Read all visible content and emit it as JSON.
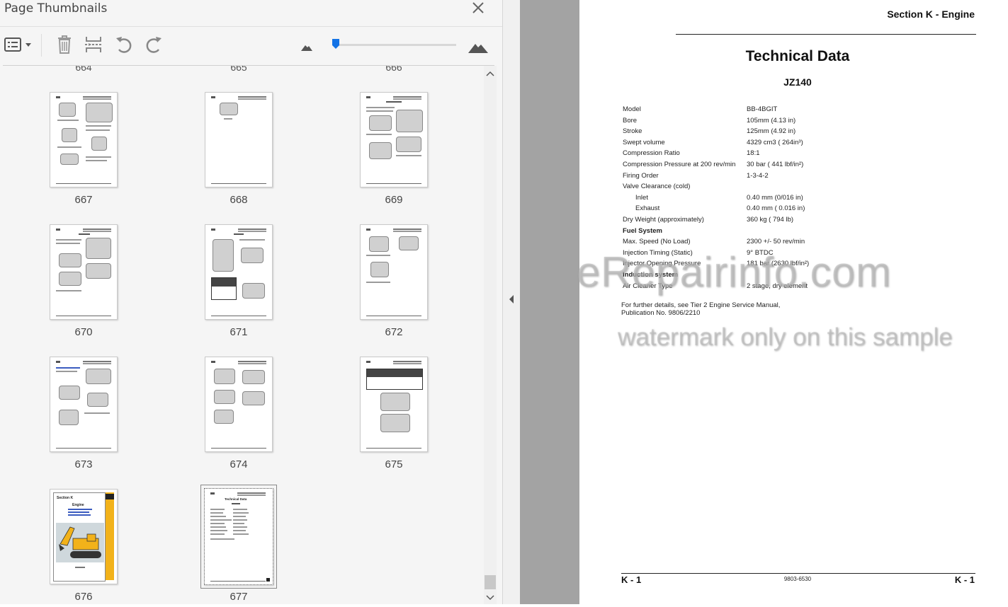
{
  "sidebar": {
    "title": "Page Thumbnails",
    "prev_row_numbers": [
      "664",
      "665",
      "666"
    ],
    "thumbnails": [
      {
        "page": "667"
      },
      {
        "page": "668"
      },
      {
        "page": "669"
      },
      {
        "page": "670"
      },
      {
        "page": "671"
      },
      {
        "page": "672"
      },
      {
        "page": "673"
      },
      {
        "page": "674"
      },
      {
        "page": "675"
      },
      {
        "page": "676"
      },
      {
        "page": "677",
        "selected": true
      }
    ],
    "cover_thumb": {
      "section": "Section K",
      "heading": "Engine"
    },
    "current_thumb": {
      "heading": "Technical Data"
    },
    "toolbar_icons": [
      "options-menu-icon",
      "delete-pages-icon",
      "insert-pages-icon",
      "rotate-counterclockwise-icon",
      "rotate-clockwise-icon",
      "small-mountain-icon",
      "large-mountain-icon"
    ],
    "zoom_slider_level": 0.03
  },
  "document": {
    "section_header": "Section K - Engine",
    "title": "Technical Data",
    "model": "JZ140",
    "specs": [
      {
        "label": "Model",
        "value": "BB-4BGIT"
      },
      {
        "label": "Bore",
        "value": "105mm (4.13 in)"
      },
      {
        "label": "Stroke",
        "value": "125mm (4.92 in)"
      },
      {
        "label": "Swept volume",
        "value": "4329 cm3 ( 264in³)"
      },
      {
        "label": "Compression Ratio",
        "value": "18:1"
      },
      {
        "label": "Compression Pressure at 200 rev/min",
        "value": "30 bar ( 441 lbf/in²)"
      },
      {
        "label": "Firing Order",
        "value": "1-3-4-2"
      },
      {
        "label": "Valve Clearance (cold)",
        "value": ""
      },
      {
        "label": "Inlet",
        "value": "0.40 mm (0/016 in)",
        "indent": true
      },
      {
        "label": "Exhaust",
        "value": "0.40 mm ( 0.016 in)",
        "indent": true
      },
      {
        "label": "Dry Weight (approximately)",
        "value": "360 kg ( 794 lb)"
      },
      {
        "label": "Fuel System",
        "value": "",
        "bold": true
      },
      {
        "label": "Max. Speed (No Load)",
        "value": "2300 +/- 50 rev/min"
      },
      {
        "label": "Injection Timing (Static)",
        "value": "9° BTDC"
      },
      {
        "label": "Injector Opening Pressure",
        "value": "181 bar (2630 lbf/in²)"
      },
      {
        "label": "Induction system",
        "value": "",
        "bold": true
      },
      {
        "label": "Air Cleaner Type",
        "value": "2 stage, dry element"
      }
    ],
    "note": "For further details, see Tier 2 Engine Service Manual, Publication No. 9806/2210",
    "footer_left": "K - 1",
    "footer_center": "9803-6530",
    "footer_right": "K - 1",
    "watermark_main": "eRepairinfo.com",
    "watermark_sub": "watermark only on this sample"
  },
  "colors": {
    "accent": "#1473e6",
    "doc_background": "#a3a3a3",
    "panel_background": "#f5f5f5"
  }
}
